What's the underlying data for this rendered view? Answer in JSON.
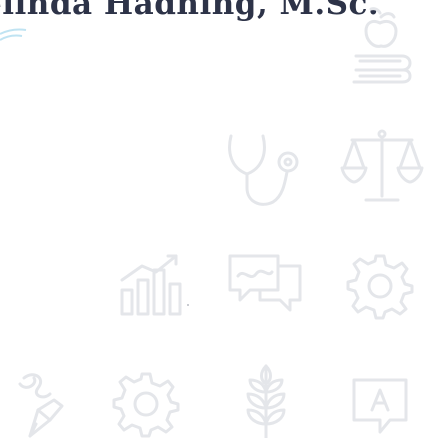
{
  "header": {
    "name_text": "elinda Hadning, M.Sc."
  },
  "colors": {
    "title": "#2d3348",
    "icon_stroke": "#e4e6ea",
    "accent_swoosh": "#bfe3f2"
  },
  "icons": [
    "apple-books-icon",
    "stethoscope-icon",
    "balance-scale-icon",
    "growth-chart-icon",
    "chat-bubbles-icon",
    "gear-icon",
    "pencil-ribbon-icon",
    "gear-icon",
    "wheat-icon",
    "speech-bubble-a-icon"
  ]
}
